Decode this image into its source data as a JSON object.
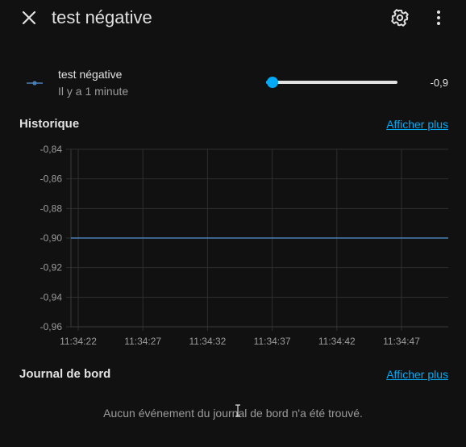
{
  "header": {
    "title": "test négative",
    "close_icon": "close-icon",
    "settings_icon": "gear-icon",
    "more_icon": "more-vert-icon"
  },
  "entity": {
    "icon": "ray-vertex-icon",
    "name": "test négative",
    "last_changed": "Il y a 1 minute",
    "slider": {
      "min": -1,
      "max": 1,
      "value": -0.9
    },
    "value_text": "-0,9"
  },
  "history": {
    "title": "Historique",
    "more_link": "Afficher plus"
  },
  "chart_data": {
    "type": "line",
    "title": "",
    "xlabel": "",
    "ylabel": "",
    "x_ticks": [
      "11:34:22",
      "11:34:27",
      "11:34:32",
      "11:34:37",
      "11:34:42",
      "11:34:47"
    ],
    "y_ticks": [
      "-0,84",
      "-0,86",
      "-0,88",
      "-0,90",
      "-0,92",
      "-0,94",
      "-0,96"
    ],
    "ylim": [
      -0.96,
      -0.84
    ],
    "grid": true,
    "series": [
      {
        "color": "#4a7fb5",
        "x": [
          "11:34:22",
          "11:34:51"
        ],
        "y": [
          -0.9,
          -0.9
        ]
      }
    ]
  },
  "logbook": {
    "title": "Journal de bord",
    "more_link": "Afficher plus",
    "empty_message": "Aucun événement du journal de bord n'a été trouvé."
  },
  "colors": {
    "background": "#111111",
    "accent": "#03a9f4",
    "line": "#4a7fb5",
    "text": "#e1e1e1",
    "secondary_text": "#9b9b9b"
  }
}
